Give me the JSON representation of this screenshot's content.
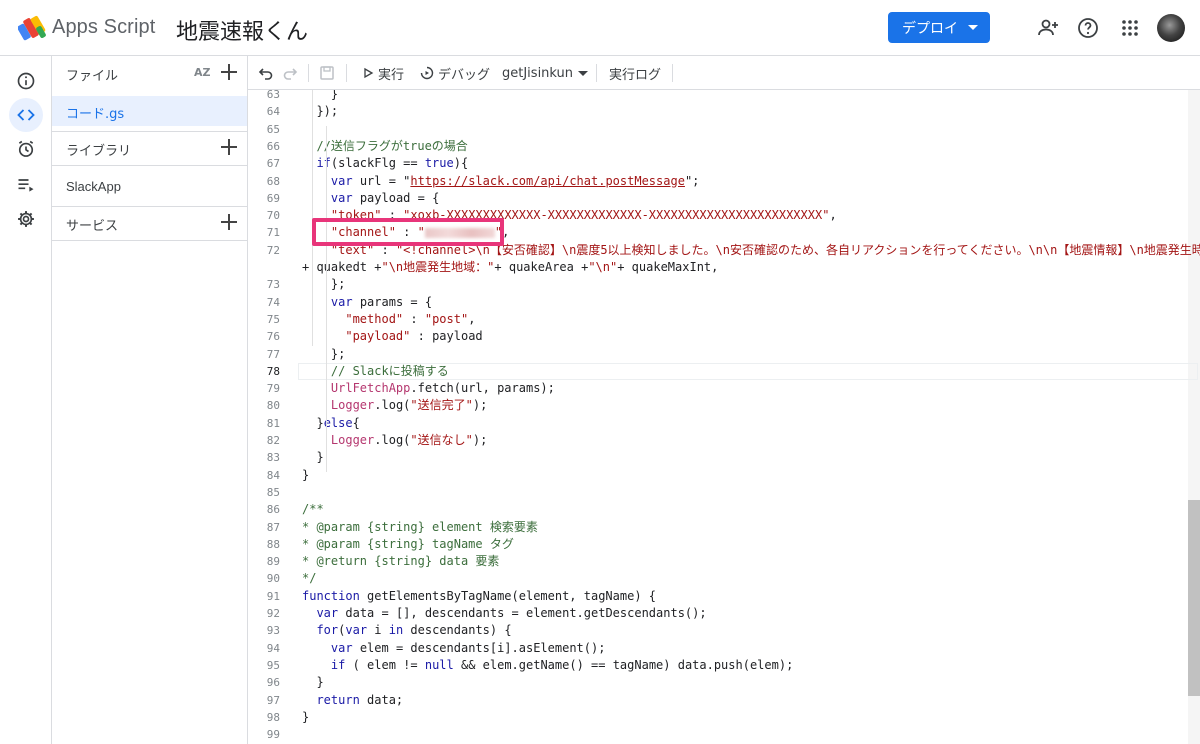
{
  "header": {
    "app_name": "Apps Script",
    "project_title": "地震速報くん",
    "deploy_label": "デプロイ",
    "icons": [
      "add-person-icon",
      "help-icon",
      "apps-grid-icon"
    ]
  },
  "rail": {
    "items": [
      "info-icon",
      "code-icon",
      "alarm-icon",
      "executions-icon",
      "settings-icon"
    ],
    "active": "code-icon"
  },
  "files": {
    "files_label": "ファイル",
    "sort_label": "AZ",
    "active_file": "コード.gs",
    "library_label": "ライブラリ",
    "library_item": "SlackApp",
    "services_label": "サービス"
  },
  "toolbar": {
    "run_label": "実行",
    "debug_label": "デバッグ",
    "function_name": "getJisinkun",
    "log_label": "実行ログ"
  },
  "editor": {
    "current_line": "78",
    "lines": [
      {
        "n": "63",
        "text": "    }"
      },
      {
        "n": "64",
        "text": "  });"
      },
      {
        "n": "65",
        "text": ""
      },
      {
        "n": "66",
        "text": "  //送信フラグがtrueの場合"
      },
      {
        "n": "67",
        "text": "  if(slackFlg == true){"
      },
      {
        "n": "68",
        "text": "    var url = \"https://slack.com/api/chat.postMessage\";"
      },
      {
        "n": "69",
        "text": "    var payload = {"
      },
      {
        "n": "70",
        "text": "    \"token\" : \"xoxb-XXXXXXXXXXXXX-XXXXXXXXXXXXX-XXXXXXXXXXXXXXXXXXXXXXXX\","
      },
      {
        "n": "71",
        "text": "    \"channel\" : \"\","
      },
      {
        "n": "72",
        "text": "    \"text\" : \"<!channel>\\n【安否確認】\\n震度5以上検知しました。\\n安否確認のため、各自リアクションを行ってください。\\n\\n【地震情報】\\n地震発生時刻：\""
      },
      {
        "n": "",
        "text": "+ quakedt +\"\\n地震発生地域：\"+ quakeArea +\"\\n\"+ quakeMaxInt,"
      },
      {
        "n": "73",
        "text": "    };"
      },
      {
        "n": "74",
        "text": "    var params = {"
      },
      {
        "n": "75",
        "text": "      \"method\" : \"post\","
      },
      {
        "n": "76",
        "text": "      \"payload\" : payload"
      },
      {
        "n": "77",
        "text": "    };"
      },
      {
        "n": "78",
        "text": "    // Slackに投稿する"
      },
      {
        "n": "79",
        "text": "    UrlFetchApp.fetch(url, params);"
      },
      {
        "n": "80",
        "text": "    Logger.log(\"送信完了\");"
      },
      {
        "n": "81",
        "text": "  }else{"
      },
      {
        "n": "82",
        "text": "    Logger.log(\"送信なし\");"
      },
      {
        "n": "83",
        "text": "  }"
      },
      {
        "n": "84",
        "text": "}"
      },
      {
        "n": "85",
        "text": ""
      },
      {
        "n": "86",
        "text": "/**"
      },
      {
        "n": "87",
        "text": "* @param {string} element 検索要素"
      },
      {
        "n": "88",
        "text": "* @param {string} tagName タグ"
      },
      {
        "n": "89",
        "text": "* @return {string} data 要素"
      },
      {
        "n": "90",
        "text": "*/"
      },
      {
        "n": "91",
        "text": "function getElementsByTagName(element, tagName) {"
      },
      {
        "n": "92",
        "text": "  var data = [], descendants = element.getDescendants();"
      },
      {
        "n": "93",
        "text": "  for(var i in descendants) {"
      },
      {
        "n": "94",
        "text": "    var elem = descendants[i].asElement();"
      },
      {
        "n": "95",
        "text": "    if ( elem != null && elem.getName() == tagName) data.push(elem);"
      },
      {
        "n": "96",
        "text": "  }"
      },
      {
        "n": "97",
        "text": "  return data;"
      },
      {
        "n": "98",
        "text": "}"
      },
      {
        "n": "99",
        "text": ""
      }
    ]
  },
  "colors": {
    "accent": "#1a73e8",
    "highlight": "#e8357a"
  }
}
